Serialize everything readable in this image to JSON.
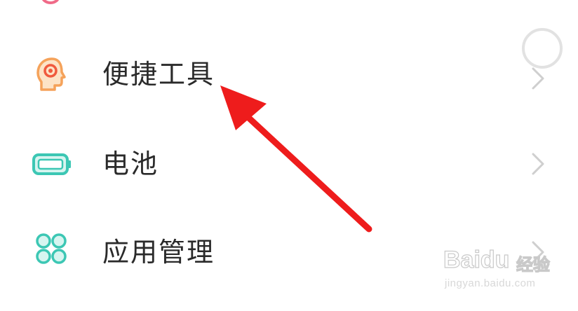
{
  "settings_list": {
    "items": [
      {
        "label": "便捷工具",
        "icon": "head-gear-icon",
        "icon_color": "#f5a25a"
      },
      {
        "label": "电池",
        "icon": "battery-icon",
        "icon_color": "#3cc7b4"
      },
      {
        "label": "应用管理",
        "icon": "app-grid-icon",
        "icon_color": "#3cc7b4"
      }
    ],
    "chevron_color": "#cfcfcf"
  },
  "annotation": {
    "arrow_color": "#ee1c1c"
  },
  "watermark": {
    "logo": "Baidu",
    "brand_cn": "经验",
    "url": "jingyan.baidu.com"
  }
}
